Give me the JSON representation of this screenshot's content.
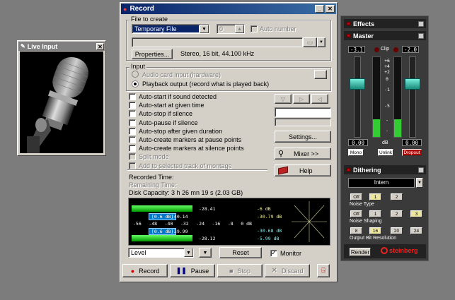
{
  "live_input": {
    "title": "Live Input"
  },
  "record": {
    "title": "Record",
    "file_group_label": "File to create",
    "file_type": "Temporary File",
    "number_value": "0",
    "auto_number_label": "Auto number",
    "properties_btn": "Properties...",
    "format_text": "Stereo, 16 bit, 44.100 kHz",
    "input_group_label": "Input",
    "input_options": [
      "Audio card input (hardware)",
      "Playback output (record what is played back)"
    ],
    "checkboxes": [
      "Auto-start if sound detected",
      "Auto-start at given time",
      "Auto-stop if silence",
      "Auto-pause if silence",
      "Auto-stop after given duration",
      "Auto-create markers at pause points",
      "Auto-create markers at silence points",
      "Split mode",
      "Add to selected track of montage"
    ],
    "settings_btn": "Settings...",
    "mixer_btn": "Mixer >>",
    "help_btn": "Help",
    "recorded_time_label": "Recorded Time:",
    "remaining_time_label": "Remaining Time:",
    "disk_capacity": "Disk Capacity: 3 h 26 mn 19 s (2.03 GB)",
    "meter": {
      "top_peak": "-28.41",
      "top_box": "[0.6 dB]",
      "top_val2": "-40.14",
      "bot_box": "[0.6 dB]",
      "bot_val2": "-39.99",
      "bot_peak": "-28.12",
      "scale": [
        "-56",
        "-48",
        "-40",
        "-32",
        "-24",
        "-16",
        "-8",
        "0 dB"
      ],
      "right_top_1": "-6 dB",
      "right_top_2": "-30.79 dB",
      "right_bot_1": "-30.68 dB",
      "right_bot_2": "-5.99 dB",
      "level_top_pct": 41,
      "level_bot_pct": 41
    },
    "level_select": "Level",
    "reset_btn": "Reset",
    "monitor_label": "Monitor",
    "transport": {
      "record": "Record",
      "pause": "Pause",
      "stop": "Stop",
      "discard": "Discard"
    }
  },
  "effects": {
    "title": "Effects",
    "master_title": "Master",
    "left_val": "-3.1",
    "right_val": "-2.0",
    "clip_label": "Clip",
    "scale": [
      "+6",
      "+4",
      "+2",
      "0",
      "-1",
      "-5",
      "-",
      "-"
    ],
    "db_label": "dB",
    "left_out": "0.00",
    "right_out": "0.00",
    "mono_btn": "Mono",
    "unlink_btn": "Unlink",
    "dropout_btn": "Dropout",
    "dithering_title": "Dithering",
    "dither_type": "Intern",
    "noise_type_label": "Noise  Type",
    "noise_shaping_label": "Noise  Shaping",
    "output_bit_label": "Output Bit Resolution",
    "row1": [
      "Off",
      "1",
      "2"
    ],
    "row2": [
      "Off",
      "1",
      "2",
      "3"
    ],
    "row3": [
      "8",
      "16",
      "20",
      "24"
    ],
    "render_btn": "Render",
    "brand": "steinberg"
  }
}
